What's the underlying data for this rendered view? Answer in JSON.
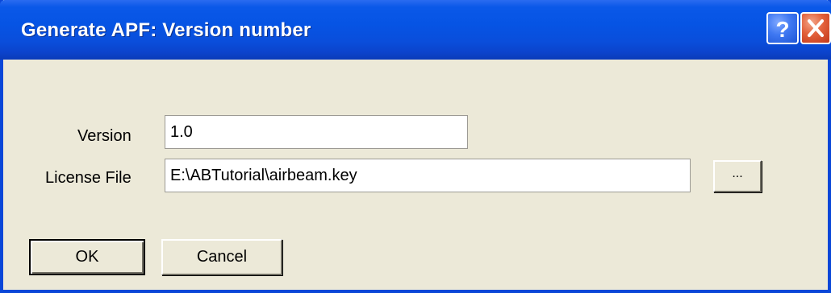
{
  "window": {
    "title": "Generate APF: Version number",
    "help_icon": "question-mark-icon",
    "close_icon": "close-x-icon"
  },
  "form": {
    "version_label": "Version",
    "version_value": "1.0",
    "license_label": "License File",
    "license_value": "E:\\ABTutorial\\airbeam.key",
    "browse_label": "..."
  },
  "buttons": {
    "ok_label": "OK",
    "cancel_label": "Cancel"
  },
  "colors": {
    "titlebar": "#0a4edb",
    "dialog_bg": "#ece9d8",
    "close_button": "#e2603a",
    "help_button": "#3f78f2"
  }
}
